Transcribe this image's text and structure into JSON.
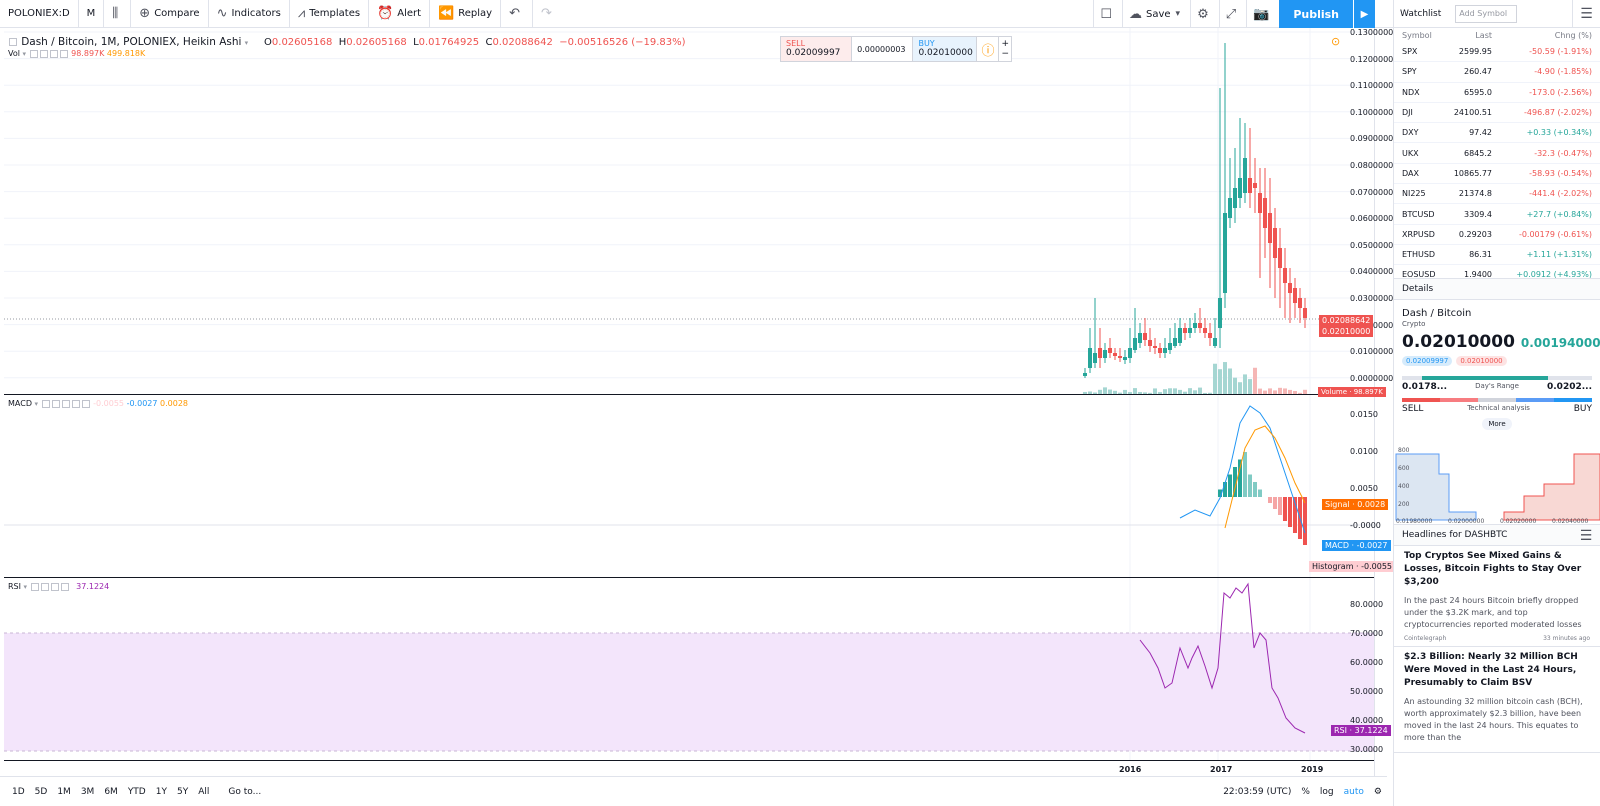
{
  "toolbar": {
    "symbol": "POLONIEX:D",
    "interval": "M",
    "compare": "Compare",
    "indicators": "Indicators",
    "templates": "Templates",
    "alert": "Alert",
    "replay": "Replay",
    "save": "Save",
    "publish": "Publish"
  },
  "legend": {
    "title": "Dash / Bitcoin, 1M, POLONIEX, Heikin Ashi",
    "o_label": "O",
    "o": "0.02605168",
    "h_label": "H",
    "h": "0.02605168",
    "l_label": "L",
    "l": "0.01764925",
    "c_label": "C",
    "c": "0.02088642",
    "change": "−0.00516526 (−19.83%)",
    "vol_label": "Vol",
    "vol1": "98.897K",
    "vol2": "499.818K"
  },
  "trade": {
    "sell_label": "SELL",
    "sell": "0.02009997",
    "spread": "0.00000003",
    "buy_label": "BUY",
    "buy": "0.02010000"
  },
  "macd_legend": {
    "label": "MACD",
    "hist": "-0.0055",
    "macd": "-0.0027",
    "signal": "0.0028"
  },
  "rsi_legend": {
    "label": "RSI",
    "value": "37.1224"
  },
  "price_axis": [
    "0.13000000",
    "0.12000000",
    "0.11000000",
    "0.10000000",
    "0.09000000",
    "0.08000000",
    "0.07000000",
    "0.06000000",
    "0.05000000",
    "0.04000000",
    "0.03000000",
    "0.02000000",
    "0.01000000",
    "0.00000000"
  ],
  "price_tags": {
    "last": "0.02088642",
    "buy": "0.02010000",
    "volume": "Volume · 98.897K"
  },
  "macd_axis": [
    "0.0150",
    "0.0100",
    "0.0050",
    "-0.0000"
  ],
  "macd_tags": {
    "signal": "Signal · 0.0028",
    "macd": "MACD · -0.0027",
    "hist": "Histogram · -0.0055"
  },
  "rsi_axis": [
    "80.0000",
    "70.0000",
    "60.0000",
    "50.0000",
    "40.0000",
    "30.0000"
  ],
  "rsi_tag": "RSI · 37.1224",
  "time_axis": [
    "2016",
    "2017",
    "2019"
  ],
  "bottom": {
    "ranges": [
      "1D",
      "5D",
      "1M",
      "3M",
      "6M",
      "YTD",
      "1Y",
      "5Y",
      "All"
    ],
    "goto": "Go to...",
    "time": "22:03:59 (UTC)",
    "pct": "%",
    "log": "log",
    "auto": "auto"
  },
  "watchlist": {
    "title": "Watchlist",
    "add_placeholder": "Add Symbol",
    "cols": {
      "symbol": "Symbol",
      "last": "Last",
      "chng": "Chng (%)"
    },
    "rows": [
      {
        "s": "SPX",
        "l": "2599.95",
        "c": "-50.59 (-1.91%)",
        "dir": "neg"
      },
      {
        "s": "SPY",
        "l": "260.47",
        "c": "-4.90 (-1.85%)",
        "dir": "neg"
      },
      {
        "s": "NDX",
        "l": "6595.0",
        "c": "-173.0 (-2.56%)",
        "dir": "neg"
      },
      {
        "s": "DJI",
        "l": "24100.51",
        "c": "-496.87 (-2.02%)",
        "dir": "neg"
      },
      {
        "s": "DXY",
        "l": "97.42",
        "c": "+0.33 (+0.34%)",
        "dir": "pos"
      },
      {
        "s": "UKX",
        "l": "6845.2",
        "c": "-32.3 (-0.47%)",
        "dir": "neg"
      },
      {
        "s": "DAX",
        "l": "10865.77",
        "c": "-58.93 (-0.54%)",
        "dir": "neg"
      },
      {
        "s": "NI225",
        "l": "21374.8",
        "c": "-441.4 (-2.02%)",
        "dir": "neg"
      },
      {
        "s": "BTCUSD",
        "l": "3309.4",
        "c": "+27.7 (+0.84%)",
        "dir": "pos"
      },
      {
        "s": "XRPUSD",
        "l": "0.29203",
        "c": "-0.00179 (-0.61%)",
        "dir": "neg"
      },
      {
        "s": "ETHUSD",
        "l": "86.31",
        "c": "+1.11 (+1.31%)",
        "dir": "pos"
      },
      {
        "s": "EOSUSD",
        "l": "1.9400",
        "c": "+0.0912 (+4.93%)",
        "dir": "pos"
      }
    ]
  },
  "details": {
    "title": "Details",
    "name": "Dash / Bitcoin",
    "type": "Crypto",
    "price": "0.02010000",
    "change": "0.00194000",
    "bid": "0.02009997",
    "ask": "0.02010000",
    "low": "0.0178...",
    "high": "0.0202...",
    "range_label": "Day's Range",
    "sell": "SELL",
    "buy": "BUY",
    "ta_label": "Technical analysis",
    "more": "More",
    "depth_y": [
      "800",
      "600",
      "400",
      "200"
    ],
    "depth_x": [
      "0.01980000",
      "0.02000000",
      "0.02020000",
      "0.02040000"
    ]
  },
  "headlines": {
    "title": "Headlines for DASHBTC",
    "items": [
      {
        "title": "Top Cryptos See Mixed Gains & Losses, Bitcoin Fights to Stay Over $3,200",
        "body": "In the past 24 hours Bitcoin briefly dropped under the $3.2K mark, and top cryptocurrencies reported moderated losses",
        "source": "Cointelegraph",
        "time": "33 minutes ago"
      },
      {
        "title": "$2.3 Billion: Nearly 32 Million BCH Were Moved in the Last 24 Hours, Presumably to Claim BSV",
        "body": "An astounding 32 million bitcoin cash (BCH), worth approximately $2.3 billion, have been moved in the last 24 hours. This equates to more than the",
        "source": "",
        "time": ""
      }
    ]
  },
  "colors": {
    "up": "#26a69a",
    "down": "#ef5350",
    "macd": "#2196f3",
    "signal": "#ff9800",
    "rsi": "#9c27b0",
    "accent": "#2196f3"
  }
}
